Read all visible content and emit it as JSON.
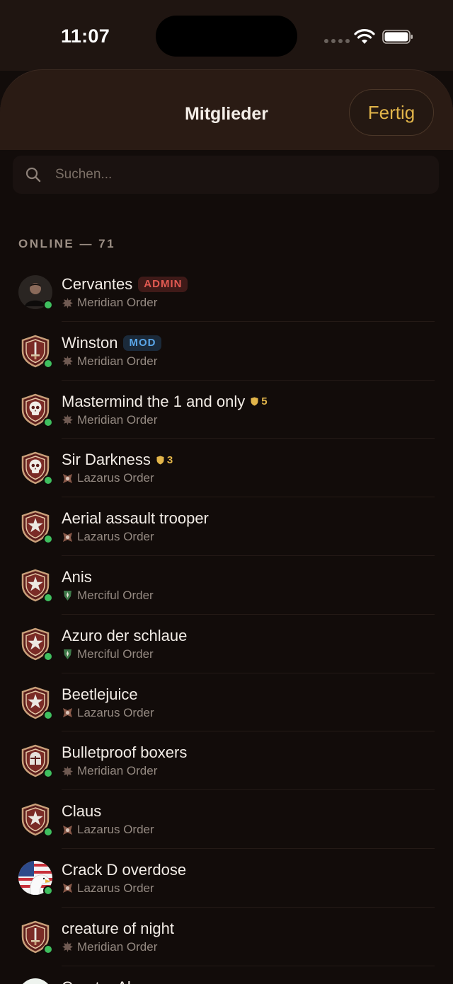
{
  "status_bar": {
    "time": "11:07"
  },
  "header": {
    "title": "Mitglieder",
    "done_label": "Fertig"
  },
  "search": {
    "placeholder": "Suchen..."
  },
  "section": {
    "title": "ONLINE — 71"
  },
  "colors": {
    "accent": "#e2b54a",
    "online": "#3fbf5f",
    "admin": "#e25a52",
    "mod": "#5aa6e8"
  },
  "members": [
    {
      "name": "Cervantes",
      "badge": "ADMIN",
      "badge_kind": "admin",
      "level": "",
      "order": "Meridian Order",
      "order_icon": "meridian-emblem-icon",
      "avatar": "photo-avatar"
    },
    {
      "name": "Winston",
      "badge": "MOD",
      "badge_kind": "mod",
      "level": "",
      "order": "Meridian Order",
      "order_icon": "meridian-emblem-icon",
      "avatar": "sword-shield-icon"
    },
    {
      "name": "Mastermind the 1 and only",
      "badge": "",
      "badge_kind": "",
      "level": "5",
      "order": "Meridian Order",
      "order_icon": "meridian-emblem-icon",
      "avatar": "skull-shield-icon"
    },
    {
      "name": "Sir Darkness",
      "badge": "",
      "badge_kind": "",
      "level": "3",
      "order": "Lazarus Order",
      "order_icon": "lazarus-emblem-icon",
      "avatar": "skull-shield-icon"
    },
    {
      "name": "Aerial assault trooper",
      "badge": "",
      "badge_kind": "",
      "level": "",
      "order": "Lazarus Order",
      "order_icon": "lazarus-emblem-icon",
      "avatar": "star-shield-icon"
    },
    {
      "name": "Anis",
      "badge": "",
      "badge_kind": "",
      "level": "",
      "order": "Merciful Order",
      "order_icon": "merciful-emblem-icon",
      "avatar": "star-shield-icon"
    },
    {
      "name": "Azuro der schlaue",
      "badge": "",
      "badge_kind": "",
      "level": "",
      "order": "Merciful Order",
      "order_icon": "merciful-emblem-icon",
      "avatar": "star-shield-icon"
    },
    {
      "name": "Beetlejuice",
      "badge": "",
      "badge_kind": "",
      "level": "",
      "order": "Lazarus Order",
      "order_icon": "lazarus-emblem-icon",
      "avatar": "star-shield-icon"
    },
    {
      "name": "Bulletproof boxers",
      "badge": "",
      "badge_kind": "",
      "level": "",
      "order": "Meridian Order",
      "order_icon": "meridian-emblem-icon",
      "avatar": "helmet-shield-icon"
    },
    {
      "name": "Claus",
      "badge": "",
      "badge_kind": "",
      "level": "",
      "order": "Lazarus Order",
      "order_icon": "lazarus-emblem-icon",
      "avatar": "star-shield-icon"
    },
    {
      "name": "Crack D overdose",
      "badge": "",
      "badge_kind": "",
      "level": "",
      "order": "Lazarus Order",
      "order_icon": "lazarus-emblem-icon",
      "avatar": "eagle-flag-avatar"
    },
    {
      "name": "creature of night",
      "badge": "",
      "badge_kind": "",
      "level": "",
      "order": "Meridian Order",
      "order_icon": "meridian-emblem-icon",
      "avatar": "sword-shield-icon"
    },
    {
      "name": "Curator Ala",
      "badge": "",
      "badge_kind": "",
      "level": "",
      "order": "",
      "order_icon": "",
      "avatar": "white-circle-avatar"
    }
  ]
}
